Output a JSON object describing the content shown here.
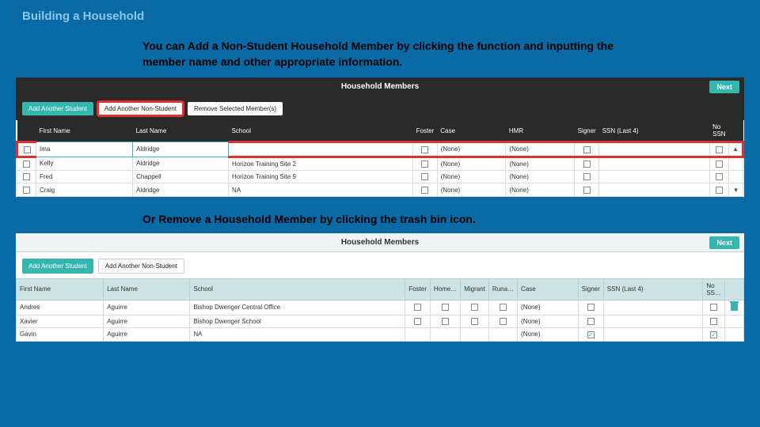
{
  "title": "Building a Household",
  "instruction1": "You can Add a Non-Student Household Member by clicking the function and inputting the member name and other appropriate information.",
  "instruction2": "Or Remove a Household Member by clicking the trash bin icon.",
  "panel1": {
    "header": "Household Members",
    "next": "Next",
    "btn_add_student": "Add Another Student",
    "btn_add_nonstudent": "Add Another Non-Student",
    "btn_remove": "Remove Selected Member(s)",
    "columns": [
      "",
      "First Name",
      "Last Name",
      "School",
      "Foster",
      "Case",
      "HMR",
      "Signer",
      "SSN (Last 4)",
      "No SSN",
      ""
    ],
    "rows": [
      {
        "first": "Ima",
        "last": "Aldridge",
        "school": "",
        "case": "(None)",
        "hmr": "(None)",
        "ssn": "",
        "editable": true
      },
      {
        "first": "Kelly",
        "last": "Aldridge",
        "school": "Horizon Training Site 2",
        "case": "(None)",
        "hmr": "(None)",
        "ssn": ""
      },
      {
        "first": "Fred",
        "last": "Chappell",
        "school": "Horizon Training Site 9",
        "case": "(None)",
        "hmr": "(None)",
        "ssn": ""
      },
      {
        "first": "Craig",
        "last": "Aldridge",
        "school": "NA",
        "case": "(None)",
        "hmr": "(None)",
        "ssn": ""
      }
    ]
  },
  "panel2": {
    "header": "Household Members",
    "next": "Next",
    "btn_add_student": "Add Another Student",
    "btn_add_nonstudent": "Add Another Non-Student",
    "columns": [
      "First Name",
      "Last Name",
      "School",
      "Foster",
      "Home…",
      "Migrant",
      "Runa…",
      "Case",
      "Signer",
      "SSN (Last 4)",
      "No SS…",
      ""
    ],
    "rows": [
      {
        "first": "Andres",
        "last": "Aguirre",
        "school": "Bishop Dwenger Central Office",
        "case": "(None)",
        "signer": false,
        "nossn": false,
        "trash": true
      },
      {
        "first": "Xavier",
        "last": "Aguirre",
        "school": "Bishop Dwenger School",
        "case": "(None)",
        "signer": false,
        "nossn": false
      },
      {
        "first": "Gavin",
        "last": "Aguirre",
        "school": "NA",
        "case": "(None)",
        "signer": true,
        "nossn": true
      }
    ]
  }
}
